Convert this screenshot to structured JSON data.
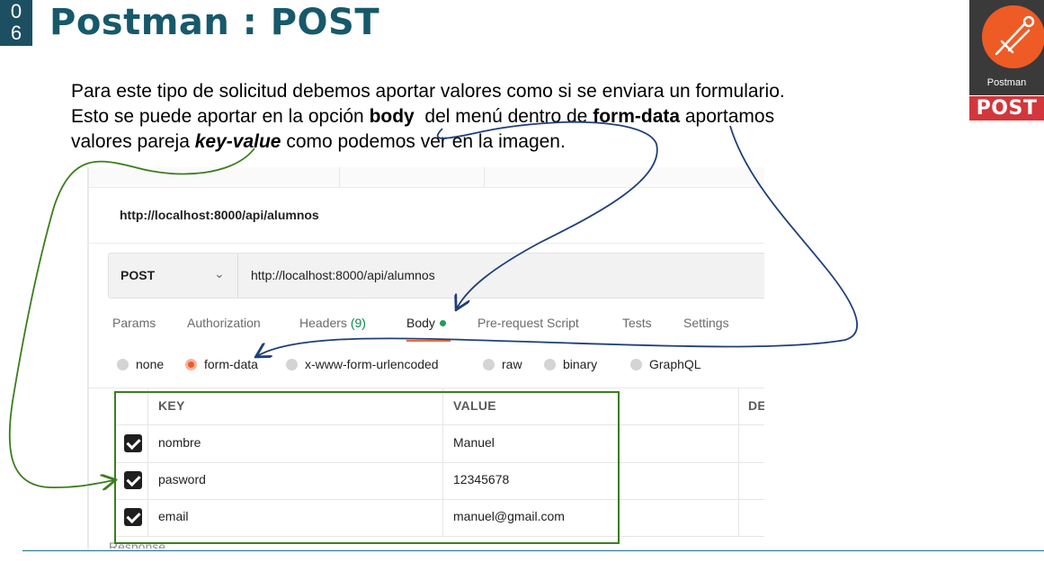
{
  "slide": {
    "number_digits": [
      "0",
      "6"
    ],
    "title": "Postman : POST",
    "logo_text": "Postman",
    "badge": "POST",
    "paragraph": {
      "line1": "Para este tipo de solicitud debemos aportar valores como si se enviara un formulario.",
      "line2_pre": "Esto se puede aportar en la opción ",
      "line2_body": "body",
      "line2_mid": "  del menú dentro de ",
      "line2_formdata": "form-data",
      "line2_post": " aportamos",
      "line3_pre": "valores pareja ",
      "line3_kv": "key-value",
      "line3_post": " como podemos ver en la imagen."
    }
  },
  "postman": {
    "request_name": "http://localhost:8000/api/alumnos",
    "method": "POST",
    "method_chevron": "chevron-down-icon",
    "url": "http://localhost:8000/api/alumnos",
    "tabs": [
      {
        "label": "Params"
      },
      {
        "label": "Authorization"
      },
      {
        "label": "Headers",
        "count": "(9)"
      },
      {
        "label": "Body",
        "active": true
      },
      {
        "label": "Pre-request Script"
      },
      {
        "label": "Tests"
      },
      {
        "label": "Settings"
      }
    ],
    "body_types": [
      {
        "label": "none",
        "selected": false
      },
      {
        "label": "form-data",
        "selected": true
      },
      {
        "label": "x-www-form-urlencoded",
        "selected": false
      },
      {
        "label": "raw",
        "selected": false
      },
      {
        "label": "binary",
        "selected": false
      },
      {
        "label": "GraphQL",
        "selected": false
      }
    ],
    "table": {
      "headers": [
        "KEY",
        "VALUE",
        "DE"
      ],
      "rows": [
        {
          "checked": true,
          "key": "nombre",
          "value": "Manuel"
        },
        {
          "checked": true,
          "key": "pasword",
          "value": "12345678"
        },
        {
          "checked": true,
          "key": "email",
          "value": "manuel@gmail.com"
        }
      ]
    },
    "response_label": "Response"
  },
  "colors": {
    "title": "#17596b",
    "postman_orange": "#ef5b25",
    "badge_red": "#d3363b",
    "annotation_blue": "#1f3f78",
    "annotation_green": "#3c7d1f"
  }
}
